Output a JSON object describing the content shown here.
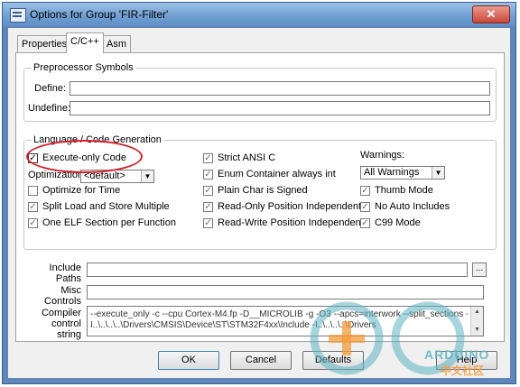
{
  "window": {
    "title": "Options for Group 'FIR-Filter'",
    "close_glyph": "✕"
  },
  "tabs": [
    {
      "label": "Properties",
      "active": false
    },
    {
      "label": "C/C++",
      "active": true
    },
    {
      "label": "Asm",
      "active": false
    }
  ],
  "preprocessor": {
    "group_label": "Preprocessor Symbols",
    "define_label": "Define:",
    "define_value": "",
    "undefine_label": "Undefine:",
    "undefine_value": ""
  },
  "language": {
    "group_label": "Language / Code Generation",
    "execute_only": {
      "label": "Execute-only Code",
      "checked": true
    },
    "optimization_label": "Optimization:",
    "optimization_value": "<default>",
    "col1": [
      {
        "label": "Optimize for Time",
        "checked": false
      },
      {
        "label": "Split Load and Store Multiple",
        "checked": true
      },
      {
        "label": "One ELF Section per Function",
        "checked": true
      }
    ],
    "col2": [
      {
        "label": "Strict ANSI C",
        "checked": true
      },
      {
        "label": "Enum Container always int",
        "checked": true
      },
      {
        "label": "Plain Char is Signed",
        "checked": true
      },
      {
        "label": "Read-Only Position Independent",
        "checked": true
      },
      {
        "label": "Read-Write Position Independent",
        "checked": true
      }
    ],
    "warnings_label": "Warnings:",
    "warnings_value": "All Warnings",
    "col3": [
      {
        "label": "Thumb Mode",
        "checked": true
      },
      {
        "label": "No Auto Includes",
        "checked": true
      },
      {
        "label": "C99 Mode",
        "checked": true
      }
    ]
  },
  "include_paths": {
    "label_line1": "Include",
    "label_line2": "Paths",
    "value": "",
    "browse_label": "..."
  },
  "misc_controls": {
    "label_line1": "Misc",
    "label_line2": "Controls",
    "value": ""
  },
  "compiler_control": {
    "label_line1": "Compiler",
    "label_line2": "control",
    "label_line3": "string",
    "line1": "--execute_only -c --cpu Cortex-M4.fp -D__MICROLIB -g -O3 --apcs=interwork --split_sections -I..\\Inc -",
    "line2": "I..\\..\\..\\..\\Drivers\\CMSIS\\Device\\ST\\STM32F4xx\\Include -I..\\..\\..\\..\\Drivers"
  },
  "buttons": {
    "ok": "OK",
    "cancel": "Cancel",
    "defaults": "Defaults",
    "help": "Help"
  },
  "watermark": {
    "text": "ARDUINO",
    "sub": "中文社区"
  },
  "colors": {
    "titlebar": "#6f9ed2",
    "highlight_ellipse": "#d4202a"
  }
}
